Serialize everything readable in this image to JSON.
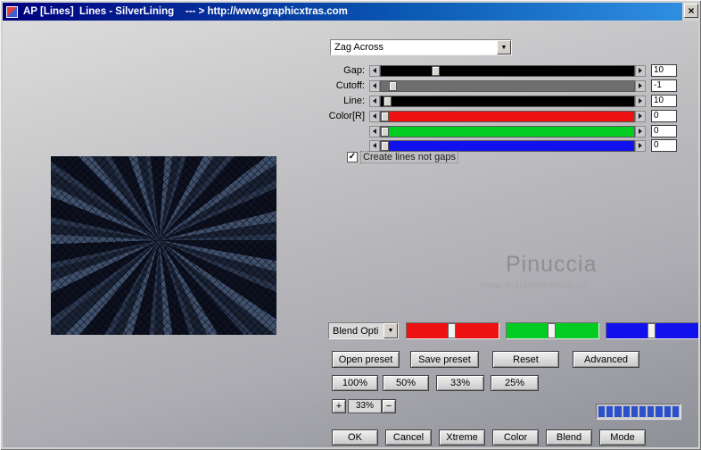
{
  "window": {
    "title": "AP [Lines]  Lines - SilverLining    --- > http://www.graphicxtras.com",
    "close_label": "×"
  },
  "pattern_dropdown": {
    "value": "Zag Across"
  },
  "sliders": [
    {
      "label": "Gap:",
      "value": "10",
      "color": "#000000",
      "handle_pct": 20
    },
    {
      "label": "Cutoff:",
      "value": "-1",
      "color": "#6e6e6e",
      "handle_pct": 3
    },
    {
      "label": "Line:",
      "value": "10",
      "color": "#000000",
      "handle_pct": 1
    },
    {
      "label": "Color[R]",
      "value": "0",
      "color": "#ee1111",
      "handle_pct": 0
    },
    {
      "label": "",
      "value": "0",
      "color": "#00cc22",
      "handle_pct": 0
    },
    {
      "label": "",
      "value": "0",
      "color": "#1111ee",
      "handle_pct": 0
    }
  ],
  "checkbox": {
    "label": "Create lines not gaps",
    "checked": true,
    "mark": "✓"
  },
  "watermark": {
    "title": "Pinuccia",
    "subtitle": "www.maidiregrafica.eu"
  },
  "blend_dropdown": {
    "value": "Blend Opti"
  },
  "color_sliders": [
    {
      "name": "red",
      "color": "#ee1111",
      "handle_pct": 45
    },
    {
      "name": "green",
      "color": "#00cc22",
      "handle_pct": 45
    },
    {
      "name": "blue",
      "color": "#1111ee",
      "handle_pct": 45
    }
  ],
  "preset_buttons": {
    "open": "Open preset",
    "save": "Save preset",
    "reset": "Reset",
    "advanced": "Advanced"
  },
  "zoom_buttons": {
    "b100": "100%",
    "b50": "50%",
    "b33": "33%",
    "b25": "25%"
  },
  "zoom_stepper": {
    "plus": "+",
    "value": "33%",
    "minus": "−"
  },
  "progress": {
    "segments": 10
  },
  "action_buttons": {
    "ok": "OK",
    "cancel": "Cancel",
    "xtreme": "Xtreme",
    "color": "Color",
    "blend": "Blend",
    "mode": "Mode"
  },
  "icons": {
    "dropdown_arrow": "▼"
  }
}
